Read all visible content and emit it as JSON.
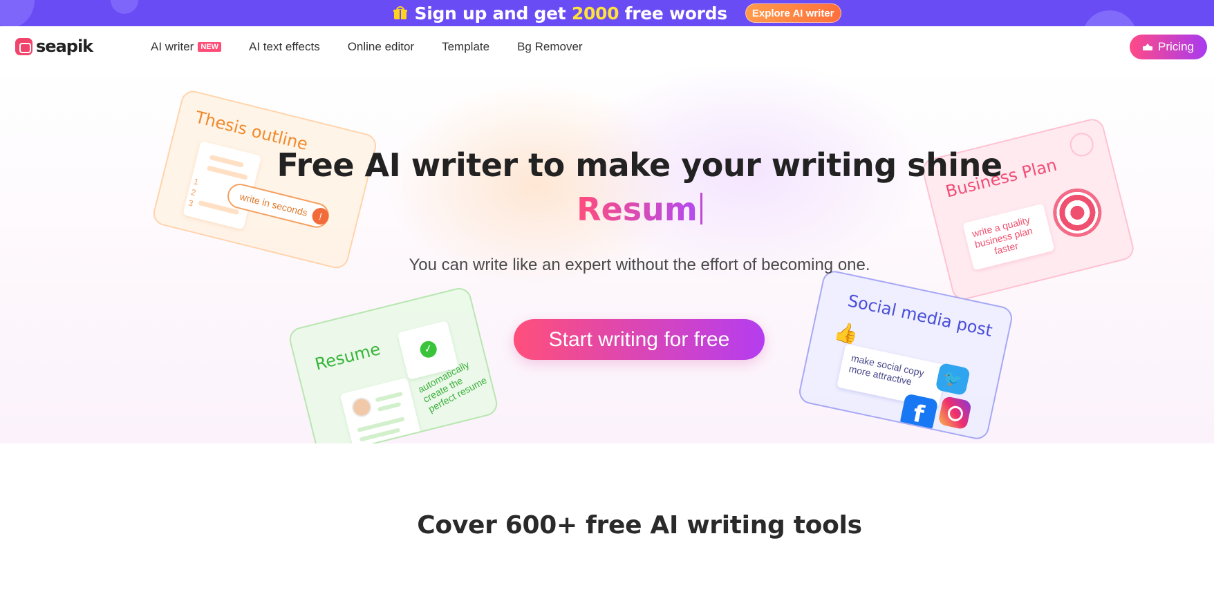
{
  "promo": {
    "text_prefix": "Sign up and get",
    "highlight_number": "2000",
    "text_suffix": "free words",
    "button_label": "Explore AI writer"
  },
  "nav": {
    "logo_text": "seapik",
    "items": [
      {
        "label": "AI writer",
        "badge": "NEW"
      },
      {
        "label": "AI text effects"
      },
      {
        "label": "Online editor"
      },
      {
        "label": "Template"
      },
      {
        "label": "Bg Remover"
      }
    ],
    "pricing_label": "Pricing"
  },
  "hero": {
    "headline": "Free AI writer to make your writing shine",
    "typed_word": "Resum",
    "subheadline": "You can write like an expert without the effort of becoming one.",
    "cta_label": "Start writing for free",
    "cards": {
      "thesis": {
        "title": "Thesis outline",
        "note": "write in seconds",
        "list_numbers": [
          "1",
          "2",
          "3"
        ]
      },
      "resume": {
        "title": "Resume",
        "note": "automatically\ncreate the\nperfect resume"
      },
      "business": {
        "title": "Business Plan",
        "note": "write a quality\nbusiness plan\nfaster"
      },
      "social": {
        "title": "Social media post",
        "note": "make social copy\nmore attractive"
      }
    }
  },
  "section": {
    "title": "Cover 600+ free AI writing tools"
  },
  "colors": {
    "promo_bg": "#6a4cf5",
    "promo_highlight": "#ffe23a",
    "brand_pink": "#ff4f7b",
    "brand_purple": "#b53df0"
  }
}
